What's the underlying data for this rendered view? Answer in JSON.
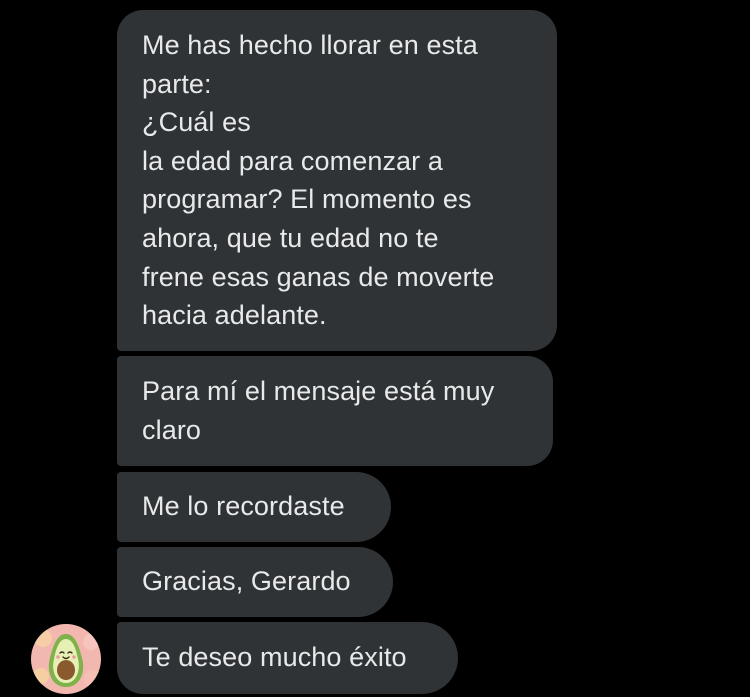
{
  "conversation": {
    "messages": [
      {
        "text": "Me has hecho llorar en esta\nparte:\n¿Cuál es\nla edad para comenzar a\nprogramar? El momento es\nahora, que tu edad no te\nfrene esas ganas de moverte\nhacia adelante."
      },
      {
        "text": "Para mí el mensaje está muy\nclaro"
      },
      {
        "text": "Me lo recordaste"
      },
      {
        "text": "Gracias, Gerardo"
      },
      {
        "text": "Te deseo mucho éxito"
      }
    ],
    "sender_avatar": {
      "icon": "avocado-avatar-icon"
    }
  },
  "colors": {
    "background": "#000000",
    "bubble": "#2f3336",
    "text": "#e7e9ea",
    "avatar_background": "#f2b8b0",
    "avocado_skin": "#7fb24a",
    "avocado_flesh": "#e6efb4",
    "avocado_pit": "#8a5a2e"
  }
}
